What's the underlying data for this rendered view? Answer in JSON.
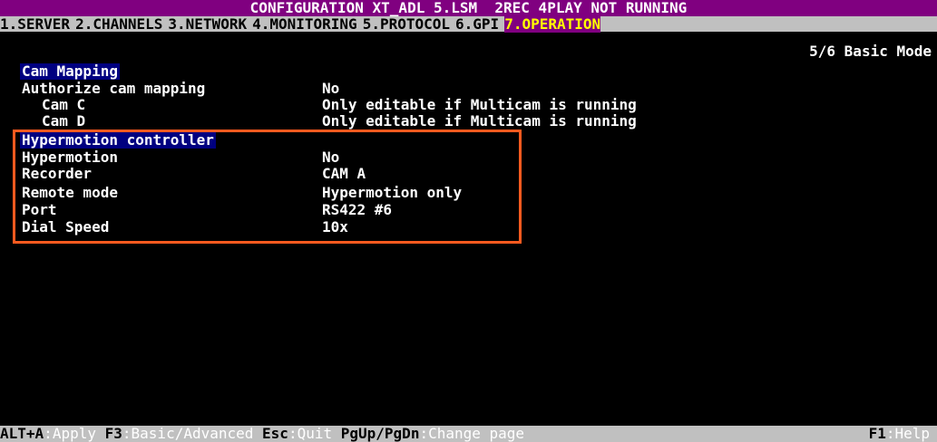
{
  "title": "CONFIGURATION XT_ADL 5.LSM  2REC 4PLAY NOT RUNNING",
  "tabs": [
    {
      "label": "1.SERVER"
    },
    {
      "label": "2.CHANNELS"
    },
    {
      "label": "3.NETWORK"
    },
    {
      "label": "4.MONITORING"
    },
    {
      "label": "5.PROTOCOL"
    },
    {
      "label": "6.GPI"
    },
    {
      "label": "7.OPERATION",
      "active": true
    }
  ],
  "page_indicator": "5/6 Basic Mode",
  "sections": {
    "cam_mapping": {
      "header": "Cam Mapping",
      "rows": [
        {
          "label": "Authorize cam mapping",
          "value": "No"
        },
        {
          "label": "Cam C",
          "value": "Only editable if Multicam is running"
        },
        {
          "label": "Cam D",
          "value": "Only editable if Multicam is running"
        }
      ]
    },
    "hypermotion": {
      "header": "Hypermotion controller",
      "rows": [
        {
          "label": "Hypermotion",
          "value": "No"
        },
        {
          "label": "Recorder",
          "value": "CAM A"
        },
        {
          "label": "Remote mode",
          "value": "Hypermotion only"
        },
        {
          "label": "Port",
          "value": "RS422 #6"
        },
        {
          "label": "Dial Speed",
          "value": "10x"
        }
      ]
    }
  },
  "status_bar": {
    "apply_key": "ALT+A",
    "apply_label": "Apply",
    "mode_key": "F3",
    "mode_label": "Basic/Advanced",
    "quit_key": "Esc",
    "quit_label": "Quit",
    "page_key": "PgUp/PgDn",
    "page_label": "Change page",
    "help_key": "F1",
    "help_label": "Help",
    "separator": ":"
  },
  "colors": {
    "background": "#000000",
    "title_bar": "#800080",
    "tab_bar": "#c0c0c0",
    "active_tab_text": "#ffff00",
    "section_header_bg": "#000080",
    "highlight_border": "#ff5a1f"
  }
}
